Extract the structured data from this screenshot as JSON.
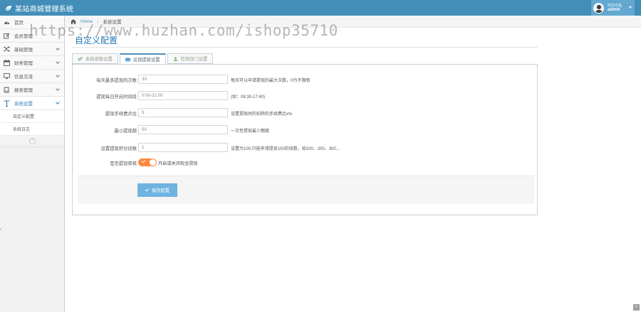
{
  "app": {
    "title": "某站商城管理系统",
    "user_welcome": "欢迎光临",
    "user_name": "admin",
    "watermark": "https://www.huzhan.com/ishop35710"
  },
  "sidebar": {
    "items": [
      {
        "label": "首页",
        "icon": "dashboard-icon",
        "has_chevron": false
      },
      {
        "label": "会员管理",
        "icon": "edit-icon",
        "has_chevron": false
      },
      {
        "label": "基础管理",
        "icon": "shuffle-icon",
        "has_chevron": true
      },
      {
        "label": "财务管理",
        "icon": "calendar-icon",
        "has_chevron": true
      },
      {
        "label": "信息交流",
        "icon": "monitor-icon",
        "has_chevron": true
      },
      {
        "label": "报表管理",
        "icon": "book-icon",
        "has_chevron": true
      },
      {
        "label": "系统设置",
        "icon": "tools-icon",
        "has_chevron": true,
        "active": true
      }
    ],
    "subitems": [
      {
        "label": "自定义配置"
      },
      {
        "label": "系统日志"
      }
    ],
    "collapse_glyph": "«"
  },
  "breadcrumb": {
    "home": "Home",
    "current": "系统设置"
  },
  "page": {
    "title": "自定义配置"
  },
  "tabs": [
    {
      "label": "系统参数设置",
      "icon": "cogs-icon"
    },
    {
      "label": "兑现提现设置",
      "icon": "credit-card-icon",
      "active": true
    },
    {
      "label": "检测部门设置",
      "icon": "user-icon"
    }
  ],
  "form": {
    "rows": [
      {
        "label": "每天最多提现的次数",
        "value": "30",
        "hint": "每天可以申请提现的最大次数，0为不限制"
      },
      {
        "label": "提现每日开启时间段",
        "value": "0:00-21:00",
        "hint": "(如：08:30-17:40)"
      },
      {
        "label": "提现手续费点位",
        "value": "5",
        "hint": "设置提现时的扣除的手续费比x%"
      },
      {
        "label": "最小提现额",
        "value": "50",
        "hint": "一次性提现最少额度"
      },
      {
        "label": "设置提现积分倍数",
        "value": "1",
        "hint": "设置为100,只能申请提现100的倍数，如100、200、300..."
      }
    ],
    "toggle": {
      "label": "是否提现审核",
      "text": "开启或关闭现金提现",
      "on": true
    },
    "save_label": "保存配置"
  },
  "colors": {
    "topbar": "#438eb9",
    "accent": "#2679b5",
    "toggle_on": "#ff893c",
    "save_button": "#6fb3e0"
  }
}
